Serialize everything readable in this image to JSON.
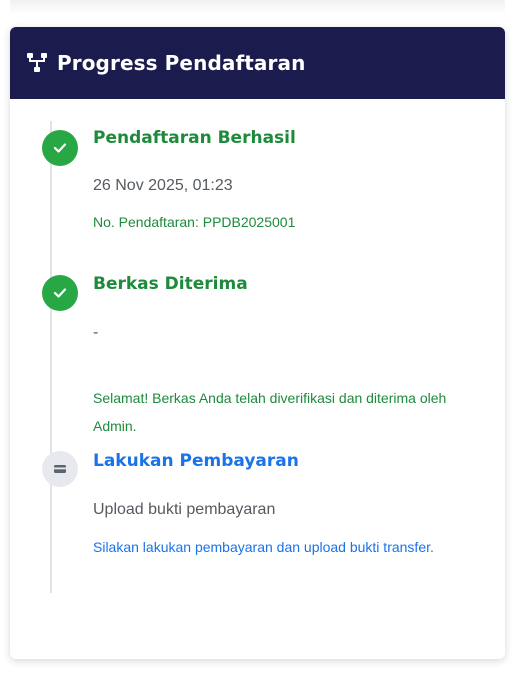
{
  "card": {
    "title": "Progress Pendaftaran",
    "header_icon": "sitemap-icon",
    "header_bg": "#1b1b4d"
  },
  "steps": [
    {
      "title": "Pendaftaran Berhasil",
      "status": "done",
      "icon": "check-icon",
      "date": "26 Nov 2025, 01:23",
      "note": "No. Pendaftaran: PPDB2025001"
    },
    {
      "title": "Berkas Diterima",
      "status": "done",
      "icon": "check-icon",
      "date": "-",
      "note": "Selamat! Berkas Anda telah diverifikasi dan diterima oleh Admin."
    },
    {
      "title": "Lakukan Pembayaran",
      "status": "pending",
      "icon": "credit-card-icon",
      "date": "Upload bukti pembayaran",
      "note": "Silakan lakukan pembayaran dan upload bukti transfer."
    }
  ],
  "colors": {
    "done": "#28a745",
    "pending": "#e7e9ee",
    "done_text": "#1e8a3c",
    "pending_text": "#1a73e8"
  }
}
